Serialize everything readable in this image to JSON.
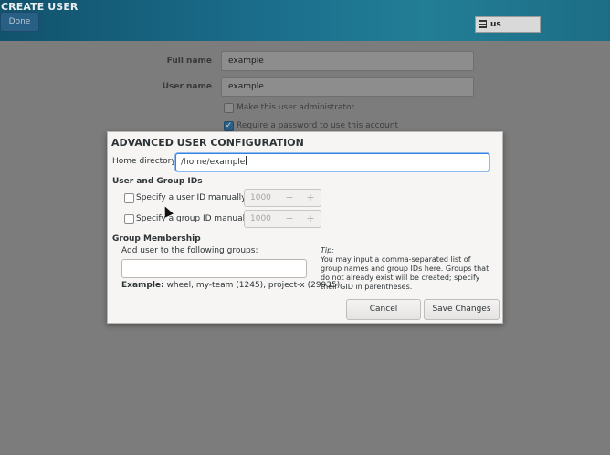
{
  "header": {
    "title": "CREATE USER",
    "done_label": "Done",
    "keyboard_layout": "us"
  },
  "background_form": {
    "full_name_label": "Full name",
    "full_name_value": "example",
    "user_name_label": "User name",
    "user_name_value": "example",
    "admin_label": "Make this user administrator",
    "password_label": "Require a password to use this account"
  },
  "dialog": {
    "title": "ADVANCED USER CONFIGURATION",
    "home_label": "Home directory:",
    "home_value": "/home/example",
    "ids_heading": "User and Group IDs",
    "uid_label": "Specify a user ID manually:",
    "uid_value": "1000",
    "gid_label": "Specify a group ID manually:",
    "gid_value": "1000",
    "minus": "−",
    "plus": "+",
    "membership_heading": "Group Membership",
    "groups_label": "Add user to the following groups:",
    "example_label": "Example:",
    "example_value": "wheel, my-team (1245), project-x (29935)",
    "tip_title": "Tip:",
    "tip_body": "You may input a comma-separated list of group names and group IDs here. Groups that do not already exist will be created; specify their GID in parentheses.",
    "cancel_label": "Cancel",
    "save_label": "Save Changes"
  },
  "colors": {
    "accent": "#3584e4",
    "header": "#1b6f8d"
  }
}
